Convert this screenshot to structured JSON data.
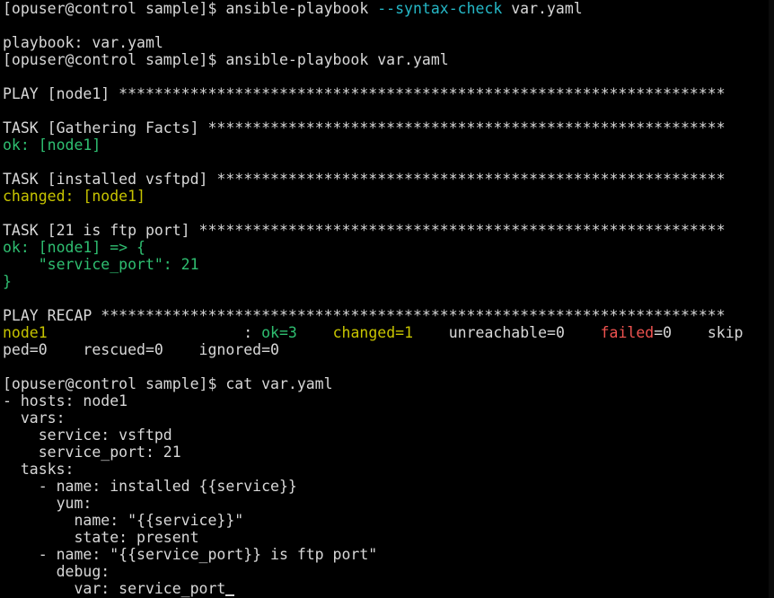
{
  "lines": [
    [
      {
        "t": "[opuser@control sample]$ ansible-playbook ",
        "c": "white"
      },
      {
        "t": "--syntax-check",
        "c": "cyan"
      },
      {
        "t": " var.yaml",
        "c": "white"
      }
    ],
    [],
    [
      {
        "t": "playbook: var.yaml",
        "c": "white"
      }
    ],
    [
      {
        "t": "[opuser@control sample]$ ansible-playbook var.yaml",
        "c": "white"
      }
    ],
    [],
    [
      {
        "t": "PLAY [node1] ********************************************************************",
        "c": "white"
      }
    ],
    [],
    [
      {
        "t": "TASK [Gathering Facts] **********************************************************",
        "c": "white"
      }
    ],
    [
      {
        "t": "ok: [node1]",
        "c": "green"
      }
    ],
    [],
    [
      {
        "t": "TASK [installed vsftpd] *********************************************************",
        "c": "white"
      }
    ],
    [
      {
        "t": "changed: [node1]",
        "c": "yellow"
      }
    ],
    [],
    [
      {
        "t": "TASK [21 is ftp port] ***********************************************************",
        "c": "white"
      }
    ],
    [
      {
        "t": "ok: [node1] => {",
        "c": "green"
      }
    ],
    [
      {
        "t": "    \"service_port\": 21",
        "c": "green"
      }
    ],
    [
      {
        "t": "}",
        "c": "green"
      }
    ],
    [],
    [
      {
        "t": "PLAY RECAP **********************************************************************",
        "c": "white"
      }
    ],
    [
      {
        "t": "node1",
        "c": "yellow"
      },
      {
        "t": "                      : ",
        "c": "white"
      },
      {
        "t": "ok=3",
        "c": "green"
      },
      {
        "t": "    ",
        "c": "white"
      },
      {
        "t": "changed=1",
        "c": "yellow"
      },
      {
        "t": "    unreachable=0    ",
        "c": "white"
      },
      {
        "t": "failed",
        "c": "red"
      },
      {
        "t": "=0    skip",
        "c": "white"
      }
    ],
    [
      {
        "t": "ped=0    rescued=0    ignored=0",
        "c": "white"
      }
    ],
    [],
    [
      {
        "t": "[opuser@control sample]$ cat var.yaml",
        "c": "white"
      }
    ],
    [
      {
        "t": "- hosts: node1",
        "c": "white"
      }
    ],
    [
      {
        "t": "  vars:",
        "c": "white"
      }
    ],
    [
      {
        "t": "    service: vsftpd",
        "c": "white"
      }
    ],
    [
      {
        "t": "    service_port: 21",
        "c": "white"
      }
    ],
    [
      {
        "t": "  tasks:",
        "c": "white"
      }
    ],
    [
      {
        "t": "    - name: installed {{service}}",
        "c": "white"
      }
    ],
    [
      {
        "t": "      yum:",
        "c": "white"
      }
    ],
    [
      {
        "t": "        name: \"{{service}}\"",
        "c": "white"
      }
    ],
    [
      {
        "t": "        state: present",
        "c": "white"
      }
    ],
    [
      {
        "t": "    - name: \"{{service_port}} is ftp port\"",
        "c": "white"
      }
    ],
    [
      {
        "t": "      debug:",
        "c": "white"
      }
    ],
    [
      {
        "t": "        var: service_port",
        "c": "white"
      },
      {
        "cursor": true
      }
    ]
  ]
}
